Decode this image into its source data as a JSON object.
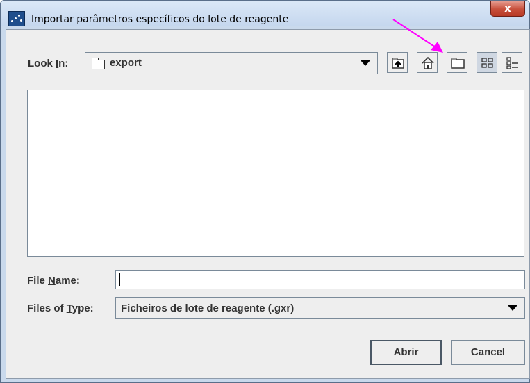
{
  "window": {
    "title": "Importar parâmetros específicos do lote de reagente",
    "close_glyph": "x"
  },
  "look_in": {
    "label_pre": "Look ",
    "label_mnemonic": "I",
    "label_post": "n:",
    "value": "export",
    "value_icon": "folder-icon"
  },
  "toolbar": {
    "buttons": [
      {
        "name": "up-one-level-button",
        "icon": "folder-up-icon"
      },
      {
        "name": "home-button",
        "icon": "home-icon"
      },
      {
        "name": "create-new-folder-button",
        "icon": "new-folder-icon"
      },
      {
        "name": "list-view-button",
        "icon": "list-view-icon",
        "selected": true
      },
      {
        "name": "details-view-button",
        "icon": "details-view-icon",
        "selected": false
      }
    ]
  },
  "annotation": {
    "type": "arrow",
    "color": "#ff00ff",
    "target": "create-new-folder-button"
  },
  "file_list": {
    "items": []
  },
  "file_name": {
    "label_pre": "File ",
    "label_mnemonic": "N",
    "label_post": "ame:",
    "value": ""
  },
  "files_of_type": {
    "label_pre": "Files of ",
    "label_mnemonic": "T",
    "label_post": "ype:",
    "value": "Ficheiros de lote de reagente (.gxr)"
  },
  "buttons": {
    "open": "Abrir",
    "cancel": "Cancel"
  },
  "colors": {
    "frame": "#c9d9ec",
    "panel": "#eeeeee",
    "close_button": "#c8503c",
    "annotation": "#ff00ff"
  }
}
